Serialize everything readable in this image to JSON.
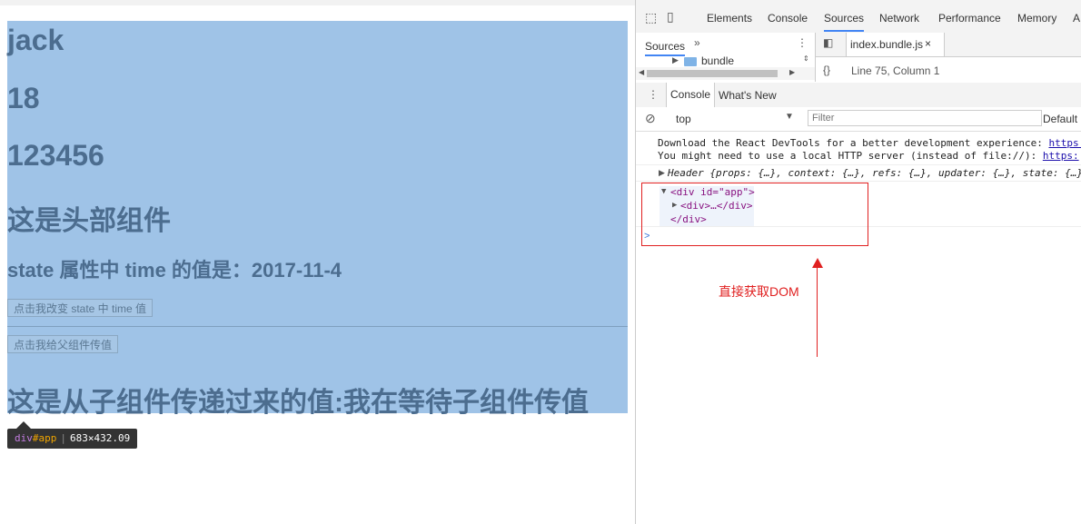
{
  "page": {
    "name_text": "jack",
    "age_text": "18",
    "number_text": "123456",
    "header_text": "这是头部组件",
    "state_text": "state 属性中 time 的值是：2017-11-4",
    "button_change_state": "点击我改变 state 中 time 值",
    "button_pass_parent": "点击我给父组件传值",
    "child_value_text": "这是从子组件传递过来的值:我在等待子组件传值"
  },
  "tooltip": {
    "tag": "div",
    "id": "#app",
    "size": "683×432.09"
  },
  "devtools": {
    "tabs": [
      "Elements",
      "Console",
      "Sources",
      "Network",
      "Performance",
      "Memory",
      "A"
    ],
    "active_tab": "Sources",
    "sources_panel_label": "Sources",
    "more_label": "»",
    "tree_item": "bundle",
    "file_tab": "index.bundle.js",
    "file_close": "×",
    "format_label": "{}",
    "position": "Line 75, Column 1",
    "drawer_tabs": [
      "Console",
      "What's New"
    ],
    "context": "top",
    "filter_placeholder": "Filter",
    "default_levels": "Default",
    "messages": [
      "Download the React DevTools for a better development experience: ",
      "You might need to use a local HTTP server (instead of file://): "
    ],
    "links": [
      "https:",
      "https:"
    ],
    "header_log": "Header {props: {…}, context: {…}, refs: {…}, updater: {…}, state: {…}",
    "dom_tree": {
      "open_tag": "<div id=\"app\">",
      "child": "<div>…</div>",
      "close_tag": "</div>"
    },
    "prompt": ">"
  },
  "annotation": {
    "text": "直接获取DOM",
    "color": "#e02020"
  }
}
